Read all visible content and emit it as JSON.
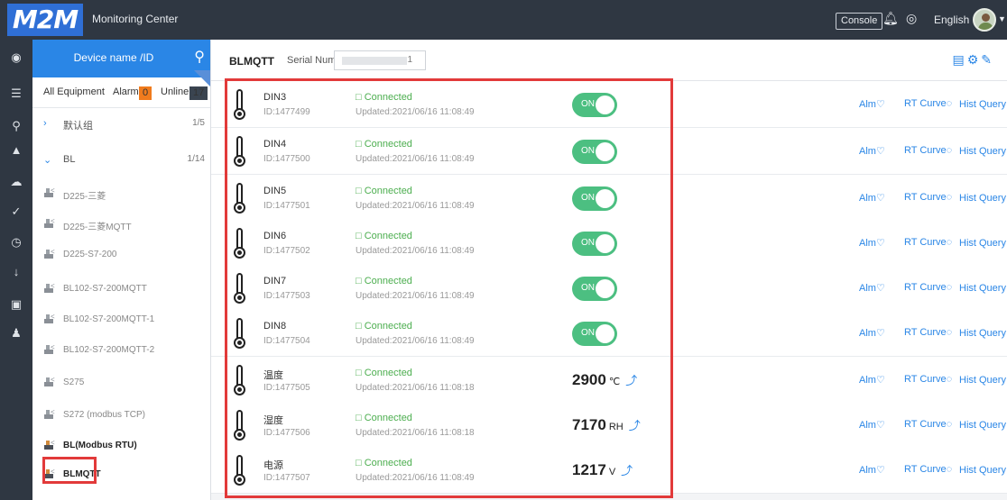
{
  "header": {
    "logo_text": "M2M",
    "app_title": "Monitoring Center",
    "console_label": "Console",
    "language": "English"
  },
  "sidebar_icons": [
    "location-icon",
    "list-icon",
    "pin-icon",
    "bell-icon",
    "cloud-icon",
    "pulse-icon",
    "clock-icon",
    "download-icon",
    "card-icon",
    "user-icon"
  ],
  "tree": {
    "search_placeholder": "Device name /ID",
    "tabs": {
      "all": "All Equipment",
      "alarm": "Alarm",
      "alarm_count": "0",
      "online": "Unline",
      "online_count": "17"
    },
    "groups": [
      {
        "label": "默认组",
        "count": "1/5",
        "expanded": false
      },
      {
        "label": "BL",
        "count": "1/14",
        "expanded": true
      }
    ],
    "devices": [
      "D225-三菱",
      "D225-三菱MQTT",
      "D225-S7-200",
      "BL102-S7-200MQTT",
      "BL102-S7-200MQTT-1",
      "BL102-S7-200MQTT-2",
      "S275",
      "S272 (modbus TCP)",
      "BL(Modbus RTU)",
      "BLMQTT"
    ],
    "selected_device": "BLMQTT"
  },
  "main": {
    "device_title": "BLMQTT",
    "serial_label": "Serial Number:",
    "serial_tail": "1",
    "actions": {
      "alarm": "Alm",
      "rt_curve": "RT Curve",
      "hist_query": "Hist Query"
    },
    "points": [
      {
        "name": "DIN3",
        "id": "ID:1477499",
        "status": "Connected",
        "updated": "Updated:2021/06/16 11:08:49",
        "type": "switch",
        "state": "ON"
      },
      {
        "name": "DIN4",
        "id": "ID:1477500",
        "status": "Connected",
        "updated": "Updated:2021/06/16 11:08:49",
        "type": "switch",
        "state": "ON"
      },
      {
        "name": "DIN5",
        "id": "ID:1477501",
        "status": "Connected",
        "updated": "Updated:2021/06/16 11:08:49",
        "type": "switch",
        "state": "ON"
      },
      {
        "name": "DIN6",
        "id": "ID:1477502",
        "status": "Connected",
        "updated": "Updated:2021/06/16 11:08:49",
        "type": "switch",
        "state": "ON"
      },
      {
        "name": "DIN7",
        "id": "ID:1477503",
        "status": "Connected",
        "updated": "Updated:2021/06/16 11:08:49",
        "type": "switch",
        "state": "ON"
      },
      {
        "name": "DIN8",
        "id": "ID:1477504",
        "status": "Connected",
        "updated": "Updated:2021/06/16 11:08:49",
        "type": "switch",
        "state": "ON"
      },
      {
        "name": "温度",
        "id": "ID:1477505",
        "status": "Connected",
        "updated": "Updated:2021/06/16 11:08:18",
        "type": "value",
        "value": "2900",
        "unit": "℃"
      },
      {
        "name": "湿度",
        "id": "ID:1477506",
        "status": "Connected",
        "updated": "Updated:2021/06/16 11:08:18",
        "type": "value",
        "value": "7170",
        "unit": "RH"
      },
      {
        "name": "电源",
        "id": "ID:1477507",
        "status": "Connected",
        "updated": "Updated:2021/06/16 11:08:49",
        "type": "value",
        "value": "1217",
        "unit": "V"
      }
    ]
  },
  "colors": {
    "accent": "#2a86e6",
    "on_toggle": "#4cbf81",
    "connected": "#4cae4f",
    "highlight": "#e23a3a",
    "topbar": "#2f3742"
  }
}
